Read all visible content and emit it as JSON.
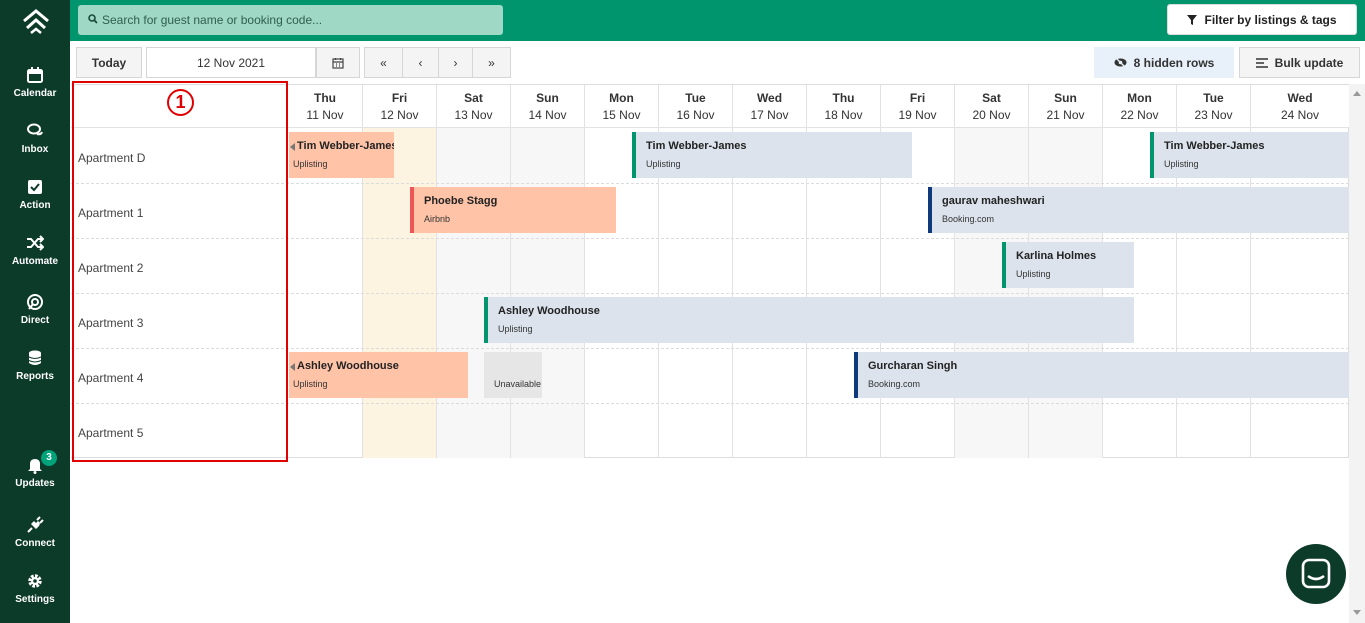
{
  "sidebar": {
    "items": [
      {
        "label": "Calendar",
        "icon": "calendar-icon"
      },
      {
        "label": "Inbox",
        "icon": "chat-bubbles-icon"
      },
      {
        "label": "Action",
        "icon": "checkbox-icon"
      },
      {
        "label": "Automate",
        "icon": "shuffle-icon"
      },
      {
        "label": "Direct",
        "icon": "direct-icon"
      },
      {
        "label": "Reports",
        "icon": "database-icon"
      },
      {
        "label": "Updates",
        "icon": "bell-icon",
        "badge": "3"
      },
      {
        "label": "Connect",
        "icon": "plug-icon"
      },
      {
        "label": "Settings",
        "icon": "gear-icon"
      }
    ]
  },
  "header": {
    "search_placeholder": "Search for guest name or booking code...",
    "filter_label": "Filter by listings & tags"
  },
  "toolbar": {
    "today_label": "Today",
    "date_value": "12 Nov 2021",
    "nav_first": "«",
    "nav_prev": "‹",
    "nav_next": "›",
    "nav_last": "»",
    "hidden_rows_label": "8 hidden rows",
    "bulk_update_label": "Bulk update"
  },
  "annotation": {
    "step": "1"
  },
  "days": [
    {
      "name": "Thu",
      "date": "11 Nov"
    },
    {
      "name": "Fri",
      "date": "12 Nov"
    },
    {
      "name": "Sat",
      "date": "13 Nov"
    },
    {
      "name": "Sun",
      "date": "14 Nov"
    },
    {
      "name": "Mon",
      "date": "15 Nov"
    },
    {
      "name": "Tue",
      "date": "16 Nov"
    },
    {
      "name": "Wed",
      "date": "17 Nov"
    },
    {
      "name": "Thu",
      "date": "18 Nov"
    },
    {
      "name": "Fri",
      "date": "19 Nov"
    },
    {
      "name": "Sat",
      "date": "20 Nov"
    },
    {
      "name": "Sun",
      "date": "21 Nov"
    },
    {
      "name": "Mon",
      "date": "22 Nov"
    },
    {
      "name": "Tue",
      "date": "23 Nov"
    },
    {
      "name": "Wed",
      "date": "24 Nov"
    }
  ],
  "listings": [
    "Apartment D",
    "Apartment 1",
    "Apartment 2",
    "Apartment 3",
    "Apartment 4",
    "Apartment 5"
  ],
  "bookings": [
    {
      "guest": "Tim Webber-James",
      "channel": "Uplisting"
    },
    {
      "guest": "Tim Webber-James",
      "channel": "Uplisting"
    },
    {
      "guest": "Tim Webber-James",
      "channel": "Uplisting"
    },
    {
      "guest": "Phoebe Stagg",
      "channel": "Airbnb"
    },
    {
      "guest": "gaurav maheshwari",
      "channel": "Booking.com"
    },
    {
      "guest": "Karlina Holmes",
      "channel": "Uplisting"
    },
    {
      "guest": "Ashley Woodhouse",
      "channel": "Uplisting"
    },
    {
      "guest": "Ashley Woodhouse",
      "channel": "Uplisting"
    },
    {
      "guest": "",
      "channel": "Unavailable"
    },
    {
      "guest": "Gurcharan Singh",
      "channel": "Booking.com"
    }
  ],
  "colors": {
    "sidebar": "#0d3b2a",
    "topbar": "#00956c",
    "today_column": "#fdf3e1",
    "weekend_column": "#f7f7f7",
    "booking_uplisting": "#dce3ec",
    "booking_highlight": "#ffc3a8",
    "annotation_red": "#e00000"
  }
}
